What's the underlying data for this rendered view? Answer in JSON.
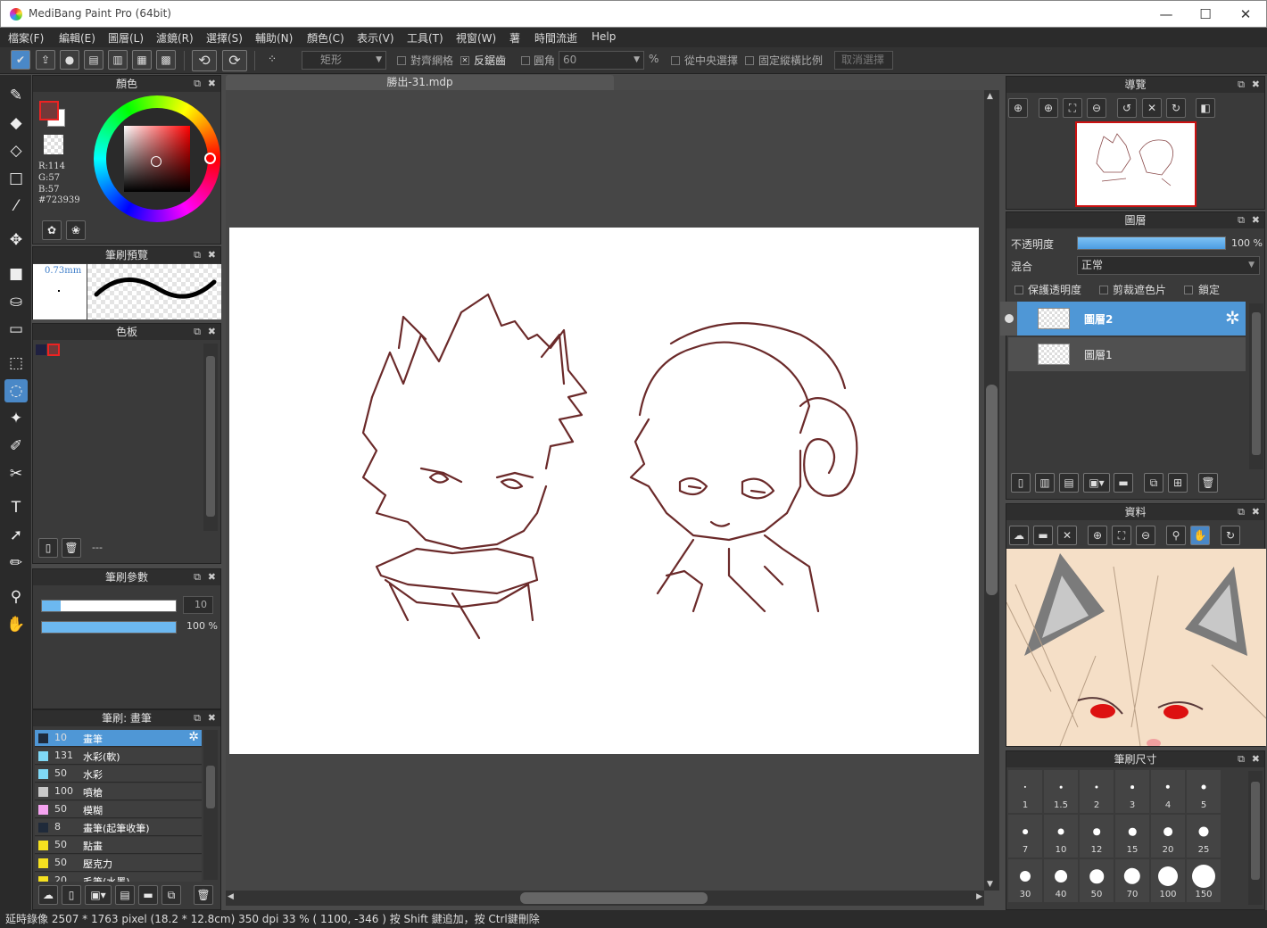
{
  "window": {
    "title": "MediBang Paint Pro (64bit)",
    "minimize": "—",
    "maximize": "☐",
    "close": "✕"
  },
  "menu": [
    "檔案(F)",
    "編輯(E)",
    "圖層(L)",
    "濾鏡(R)",
    "選擇(S)",
    "輔助(N)",
    "顏色(C)",
    "表示(V)",
    "工具(T)",
    "視窗(W)",
    "薯",
    "時間流逝",
    "Help"
  ],
  "toolbar": {
    "select_shape": "矩形",
    "snap_grid": "對齊網格",
    "antialias": "反鋸齒",
    "round_corner": "圓角",
    "round_value": "60",
    "percent": "%",
    "from_center": "從中央選擇",
    "fixed_ratio": "固定縱橫比例",
    "cancel_select": "取消選擇"
  },
  "color_panel": {
    "title": "顏色",
    "r": "R:114",
    "g": "G:57",
    "b": "B:57",
    "hex": "#723939",
    "fg": "#723939",
    "bg": "#ffffff"
  },
  "brush_preview": {
    "title": "筆刷預覽",
    "size": "0.73mm"
  },
  "palette": {
    "title": "色板",
    "name": "---"
  },
  "brush_params": {
    "title": "筆刷參數",
    "size_value": "10",
    "opacity_value": "100 %",
    "size_fraction": 0.14,
    "opacity_fraction": 1.0
  },
  "brush_list": {
    "title": "筆刷: 畫筆",
    "items": [
      {
        "num": "10",
        "name": "畫筆",
        "color": "#1f2a3a",
        "selected": true
      },
      {
        "num": "131",
        "name": "水彩(軟)",
        "color": "#7fd8f5"
      },
      {
        "num": "50",
        "name": "水彩",
        "color": "#7fd8f5"
      },
      {
        "num": "100",
        "name": "噴槍",
        "color": "#c8c8c8"
      },
      {
        "num": "50",
        "name": "模糊",
        "color": "#f5a3f0"
      },
      {
        "num": "8",
        "name": "畫筆(起筆收筆)",
        "color": "#1f2a3a"
      },
      {
        "num": "50",
        "name": "點畫",
        "color": "#f5e020"
      },
      {
        "num": "50",
        "name": "壓克力",
        "color": "#f5e020"
      },
      {
        "num": "20",
        "name": "毛筆(水墨)",
        "color": "#f5e020"
      }
    ]
  },
  "canvas": {
    "tab": "勝出-31.mdp"
  },
  "navigator": {
    "title": "導覽"
  },
  "layers": {
    "title": "圖層",
    "opacity_label": "不透明度",
    "opacity_value": "100 %",
    "blend_label": "混合",
    "blend_value": "正常",
    "protect_alpha": "保護透明度",
    "clipping": "剪裁遮色片",
    "lock": "鎖定",
    "items": [
      {
        "name": "圖層2",
        "selected": true
      },
      {
        "name": "圖層1",
        "selected": false
      }
    ]
  },
  "materials": {
    "title": "資料"
  },
  "brush_size": {
    "title": "筆刷尺寸",
    "sizes": [
      "1",
      "1.5",
      "2",
      "3",
      "4",
      "5",
      "7",
      "10",
      "12",
      "15",
      "20",
      "25",
      "30",
      "40",
      "50",
      "70",
      "100",
      "150"
    ]
  },
  "status": "延時錄像   2507 * 1763 pixel  (18.2 * 12.8cm)  350 dpi  33 %  ( 1100, -346 )  按 Shift 鍵追加，按 Ctrl鍵刪除"
}
